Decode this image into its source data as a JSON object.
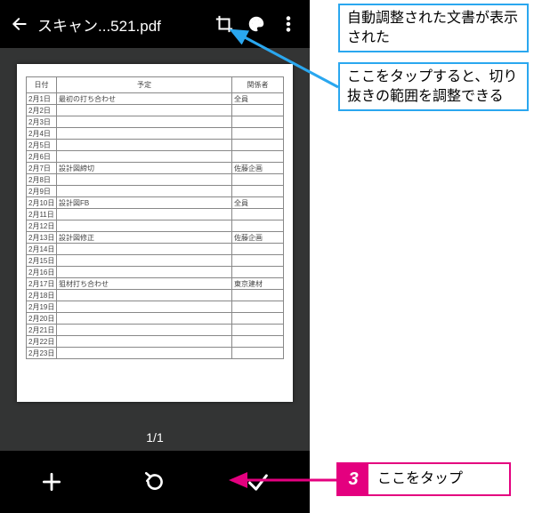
{
  "topbar": {
    "title": "スキャン...521.pdf"
  },
  "page_position": "1/1",
  "doc": {
    "headers": {
      "date": "日付",
      "plan": "予定",
      "rel": "関係者"
    },
    "rows": [
      {
        "date": "2月1日",
        "plan": "最初の打ち合わせ",
        "rel": "全員"
      },
      {
        "date": "2月2日",
        "plan": "",
        "rel": ""
      },
      {
        "date": "2月3日",
        "plan": "",
        "rel": ""
      },
      {
        "date": "2月4日",
        "plan": "",
        "rel": ""
      },
      {
        "date": "2月5日",
        "plan": "",
        "rel": ""
      },
      {
        "date": "2月6日",
        "plan": "",
        "rel": ""
      },
      {
        "date": "2月7日",
        "plan": "設計図締切",
        "rel": "佐藤企画"
      },
      {
        "date": "2月8日",
        "plan": "",
        "rel": ""
      },
      {
        "date": "2月9日",
        "plan": "",
        "rel": ""
      },
      {
        "date": "2月10日",
        "plan": "設計図FB",
        "rel": "全員"
      },
      {
        "date": "2月11日",
        "plan": "",
        "rel": ""
      },
      {
        "date": "2月12日",
        "plan": "",
        "rel": ""
      },
      {
        "date": "2月13日",
        "plan": "設計図修正",
        "rel": "佐藤企画"
      },
      {
        "date": "2月14日",
        "plan": "",
        "rel": ""
      },
      {
        "date": "2月15日",
        "plan": "",
        "rel": ""
      },
      {
        "date": "2月16日",
        "plan": "",
        "rel": ""
      },
      {
        "date": "2月17日",
        "plan": "狙材打ち合わせ",
        "rel": "東京建材"
      },
      {
        "date": "2月18日",
        "plan": "",
        "rel": ""
      },
      {
        "date": "2月19日",
        "plan": "",
        "rel": ""
      },
      {
        "date": "2月20日",
        "plan": "",
        "rel": ""
      },
      {
        "date": "2月21日",
        "plan": "",
        "rel": ""
      },
      {
        "date": "2月22日",
        "plan": "",
        "rel": ""
      },
      {
        "date": "2月23日",
        "plan": "",
        "rel": ""
      }
    ]
  },
  "callouts": {
    "c1": "自動調整された文書が表示された",
    "c2": "ここをタップすると、切り抜きの範囲を調整できる",
    "c3_num": "3",
    "c3_txt": "ここをタップ"
  }
}
